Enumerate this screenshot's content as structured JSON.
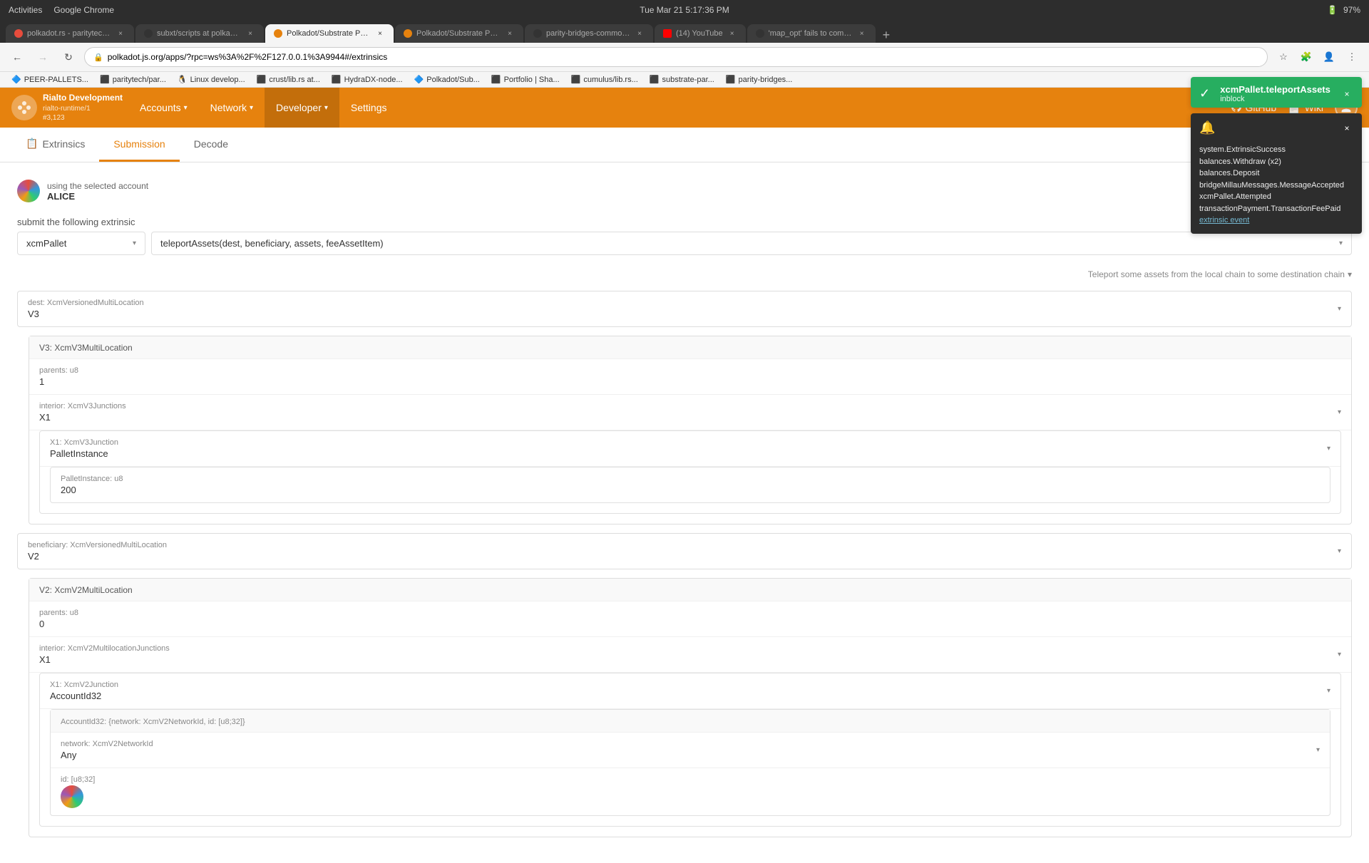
{
  "os_bar": {
    "left_items": [
      "Activities",
      "Google Chrome"
    ],
    "center": "Tue Mar 21  5:17:36 PM",
    "right_items": [
      "97%"
    ]
  },
  "tabs": [
    {
      "id": "t1",
      "title": "polkadot.rs - paritytech/p...",
      "favicon": "dot",
      "active": false
    },
    {
      "id": "t2",
      "title": "subxt/scripts at polkado...",
      "favicon": "gh",
      "active": false
    },
    {
      "id": "t3",
      "title": "Polkadot/Substrate Port...",
      "favicon": "dot2",
      "active": true
    },
    {
      "id": "t4",
      "title": "Polkadot/Substrate Port...",
      "favicon": "dot2",
      "active": false
    },
    {
      "id": "t5",
      "title": "parity-bridges-common/...",
      "favicon": "gh",
      "active": false
    },
    {
      "id": "t6",
      "title": "(14) YouTube",
      "favicon": "yt",
      "active": false
    },
    {
      "id": "t7",
      "title": "'map_opt' fails to compl...",
      "favicon": "gh",
      "active": false
    }
  ],
  "address_bar": {
    "url": "polkadot.js.org/apps/?rpc=ws%3A%2F%2F127.0.0.1%3A9944#/extrinsics"
  },
  "bookmarks": [
    {
      "label": "PEER-PALLETS...",
      "icon": "🔷"
    },
    {
      "label": "paritytech/par...",
      "icon": "⬛"
    },
    {
      "label": "Linux develop...",
      "icon": "🐧"
    },
    {
      "label": "crust/lib.rs at...",
      "icon": "⬛"
    },
    {
      "label": "HydraDX-node...",
      "icon": "⬛"
    },
    {
      "label": "Polkadot/Sub...",
      "icon": "🔷"
    },
    {
      "label": "Portfolio | Sha...",
      "icon": "⬛"
    },
    {
      "label": "cumulus/lib.rs...",
      "icon": "⬛"
    },
    {
      "label": "substrate-par...",
      "icon": "⬛"
    },
    {
      "label": "parity-bridges...",
      "icon": "⬛"
    }
  ],
  "header": {
    "logo": {
      "title": "Rialto Development",
      "subtitle": "rialto-runtime/1",
      "block": "#3,123"
    },
    "nav_items": [
      {
        "label": "Accounts",
        "has_dropdown": true
      },
      {
        "label": "Network",
        "has_dropdown": true
      },
      {
        "label": "Developer",
        "has_dropdown": true
      },
      {
        "label": "Settings",
        "has_dropdown": false
      }
    ],
    "right_links": [
      {
        "label": "GitHub",
        "icon": "⬛"
      },
      {
        "label": "Wiki",
        "icon": "📄"
      }
    ]
  },
  "page_tabs": [
    {
      "label": "Extrinsics",
      "icon": "📋",
      "active": false
    },
    {
      "label": "Submission",
      "icon": "",
      "active": true
    },
    {
      "label": "Decode",
      "icon": "",
      "active": false
    }
  ],
  "form": {
    "account_label": "using the selected account",
    "account_name": "ALICE",
    "submit_label": "submit the following extrinsic",
    "pallet_value": "xcmPallet",
    "method_value": "teleportAssets(dest, beneficiary, assets, feeAssetItem)",
    "hint_text": "Teleport some assets from the local chain to some destination chain",
    "params": {
      "dest_label": "dest: XcmVersionedMultiLocation",
      "dest_value": "V3",
      "dest_type": "V3: XcmV3MultiLocation",
      "parents_label": "parents: u8",
      "parents_value": "1",
      "interior_label": "interior: XcmV3Junctions",
      "interior_value": "X1",
      "x1_label": "X1: XcmV3Junction",
      "x1_value": "PalletInstance",
      "pallet_instance_label": "PalletInstance: u8",
      "pallet_instance_value": "200",
      "beneficiary_label": "beneficiary: XcmVersionedMultiLocation",
      "beneficiary_value": "V2",
      "beneficiary_type": "V2: XcmV2MultiLocation",
      "ben_parents_label": "parents: u8",
      "ben_parents_value": "0",
      "ben_interior_label": "interior: XcmV2MultilocationJunctions",
      "ben_interior_value": "X1",
      "ben_x1_label": "X1: XcmV2Junction",
      "ben_x1_value": "AccountId32",
      "account_id32_label": "AccountId32: {network: XcmV2NetworkId, id: [u8;32]}",
      "network_label": "network: XcmV2NetworkId",
      "network_value": "Any",
      "id_label": "id: [u8;32]"
    }
  },
  "notifications": [
    {
      "type": "success",
      "title": "xcmPallet.teleportAssets",
      "subtitle": "inblock",
      "icon": "✓"
    },
    {
      "type": "info",
      "title": "",
      "body_lines": [
        "system.ExtrinsicSuccess",
        "balances.Withdraw (x2)",
        "balances.Deposit",
        "bridgeMillauMessages.MessageAccepted",
        "xcmPallet.Attempted",
        "transactionPayment.TransactionFeePaid"
      ],
      "link_text": "extrinsic event",
      "icon": "🔔"
    }
  ]
}
